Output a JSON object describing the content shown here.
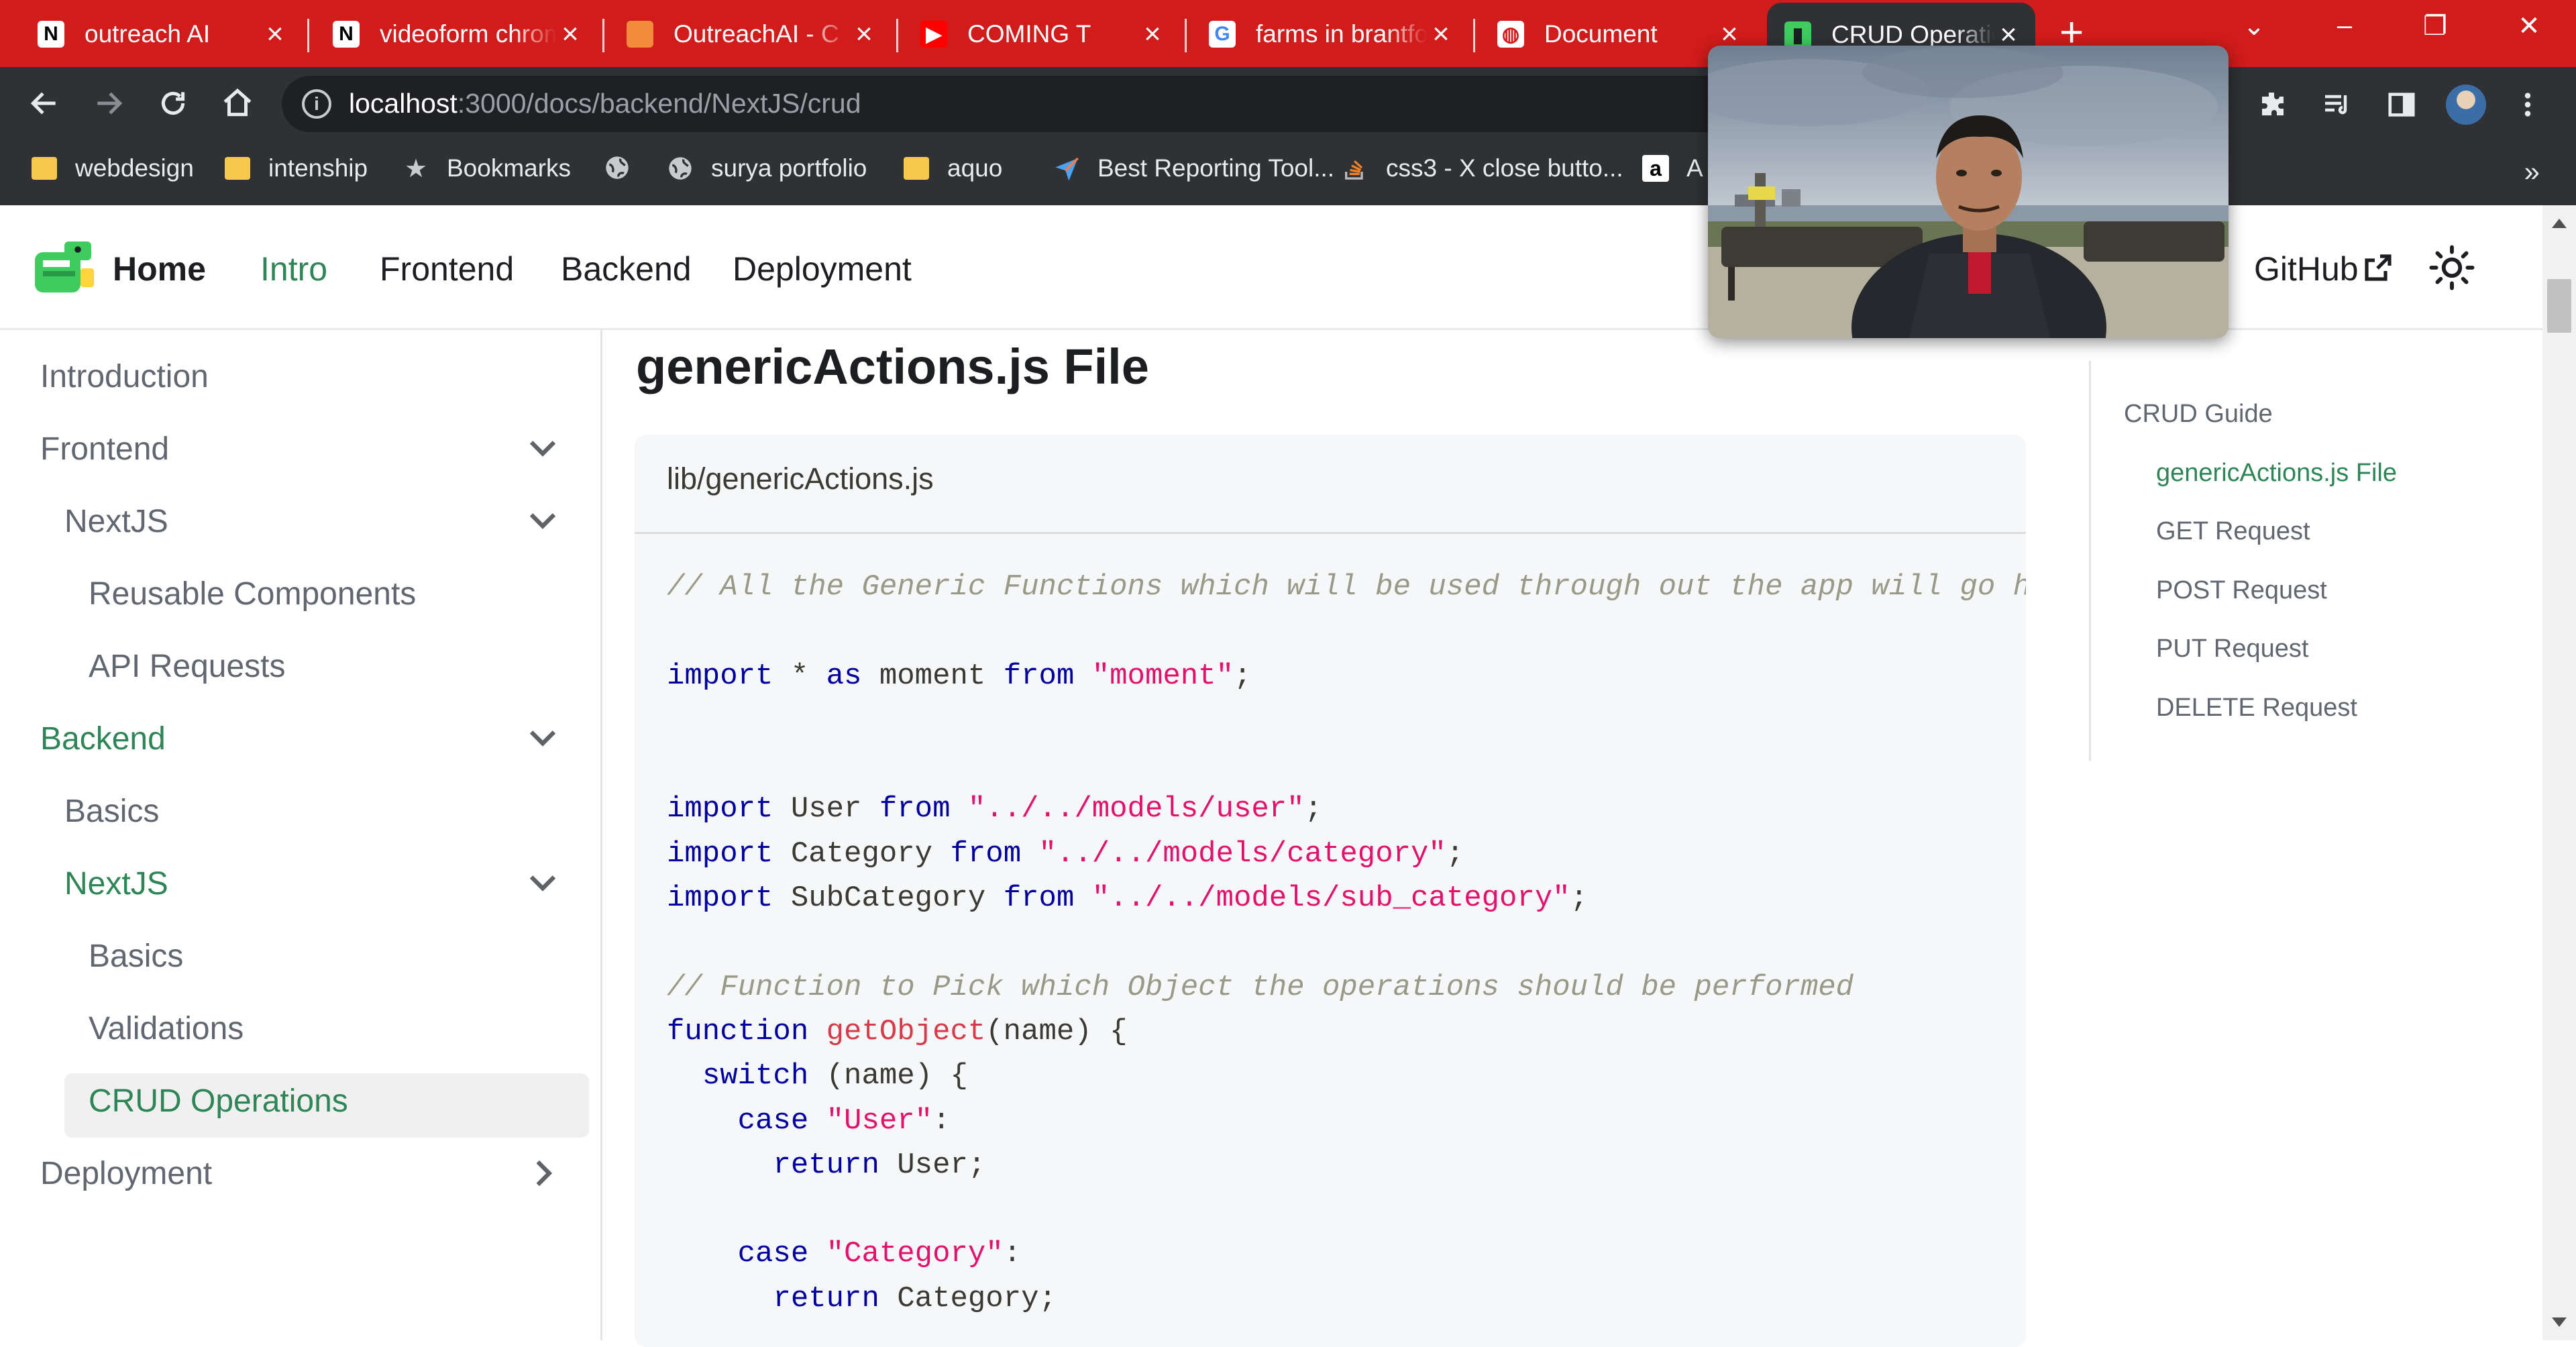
{
  "tabs": [
    {
      "title": "outreach AI",
      "icon": "notion-icon",
      "active": false
    },
    {
      "title": "videoform chrome",
      "icon": "notion-icon",
      "active": false
    },
    {
      "title": "OutreachAI - C",
      "icon": "folder-icon",
      "active": false
    },
    {
      "title": "COMING T",
      "icon": "youtube-icon",
      "active": false
    },
    {
      "title": "farms in brantford",
      "icon": "google-icon",
      "active": false
    },
    {
      "title": "Document",
      "icon": "globe-icon",
      "active": false
    },
    {
      "title": "CRUD Operations",
      "icon": "docusaurus-icon",
      "active": true
    }
  ],
  "address": {
    "host": "localhost",
    "path": ":3000/docs/backend/NextJS/crud"
  },
  "bookmarks": [
    {
      "label": "webdesign",
      "icon": "folder-icon"
    },
    {
      "label": "intenship",
      "icon": "folder-icon"
    },
    {
      "label": "Bookmarks",
      "icon": "star-icon"
    },
    {
      "label": "",
      "icon": "globe-icon"
    },
    {
      "label": "surya portfolio",
      "icon": "globe-icon"
    },
    {
      "label": "aquo",
      "icon": "folder-icon"
    },
    {
      "label": "Best Reporting Tool...",
      "icon": "send-icon"
    },
    {
      "label": "css3 - X close butto...",
      "icon": "stackoverflow-icon"
    },
    {
      "label": "A",
      "icon": "amazon-icon"
    }
  ],
  "site": {
    "nav": {
      "home": "Home",
      "intro": "Intro",
      "frontend": "Frontend",
      "backend": "Backend",
      "deployment": "Deployment",
      "github": "GitHub"
    }
  },
  "sidebar": {
    "items": [
      {
        "label": "Introduction",
        "level": 0,
        "active": false
      },
      {
        "label": "Frontend",
        "level": 0,
        "active": false,
        "chevron": "down"
      },
      {
        "label": "NextJS",
        "level": 1,
        "active": false,
        "chevron": "down"
      },
      {
        "label": "Reusable Components",
        "level": 2,
        "active": false
      },
      {
        "label": "API Requests",
        "level": 2,
        "active": false
      },
      {
        "label": "Backend",
        "level": 0,
        "active": true,
        "chevron": "down"
      },
      {
        "label": "Basics",
        "level": 1,
        "active": false
      },
      {
        "label": "NextJS",
        "level": 1,
        "active": true,
        "chevron": "down"
      },
      {
        "label": "Basics",
        "level": 2,
        "active": false
      },
      {
        "label": "Validations",
        "level": 2,
        "active": false
      },
      {
        "label": "CRUD Operations",
        "level": 2,
        "active": true,
        "selected": true
      },
      {
        "label": "Deployment",
        "level": 0,
        "active": false,
        "chevron": "right"
      }
    ]
  },
  "content": {
    "heading": "genericActions.js File",
    "code_title": "lib/genericActions.js",
    "code_lines": [
      [
        {
          "t": "// All the Generic Functions which will be used through out the app will go here",
          "c": "cmt"
        }
      ],
      [],
      [
        {
          "t": "import",
          "c": "kw"
        },
        {
          "t": " * "
        },
        {
          "t": "as",
          "c": "kw"
        },
        {
          "t": " moment "
        },
        {
          "t": "from",
          "c": "kw"
        },
        {
          "t": " "
        },
        {
          "t": "\"moment\"",
          "c": "str"
        },
        {
          "t": ";"
        }
      ],
      [],
      [],
      [
        {
          "t": "import",
          "c": "kw"
        },
        {
          "t": " User "
        },
        {
          "t": "from",
          "c": "kw"
        },
        {
          "t": " "
        },
        {
          "t": "\"../../models/user\"",
          "c": "str"
        },
        {
          "t": ";"
        }
      ],
      [
        {
          "t": "import",
          "c": "kw"
        },
        {
          "t": " Category "
        },
        {
          "t": "from",
          "c": "kw"
        },
        {
          "t": " "
        },
        {
          "t": "\"../../models/category\"",
          "c": "str"
        },
        {
          "t": ";"
        }
      ],
      [
        {
          "t": "import",
          "c": "kw"
        },
        {
          "t": " SubCategory "
        },
        {
          "t": "from",
          "c": "kw"
        },
        {
          "t": " "
        },
        {
          "t": "\"../../models/sub_category\"",
          "c": "str"
        },
        {
          "t": ";"
        }
      ],
      [],
      [
        {
          "t": "// Function to Pick which Object the operations should be performed",
          "c": "cmt"
        }
      ],
      [
        {
          "t": "function",
          "c": "kw"
        },
        {
          "t": " "
        },
        {
          "t": "getObject",
          "c": "fn"
        },
        {
          "t": "(name) {"
        }
      ],
      [
        {
          "t": "  "
        },
        {
          "t": "switch",
          "c": "kw"
        },
        {
          "t": " (name) {"
        }
      ],
      [
        {
          "t": "    "
        },
        {
          "t": "case",
          "c": "kw"
        },
        {
          "t": " "
        },
        {
          "t": "\"User\"",
          "c": "str"
        },
        {
          "t": ":"
        }
      ],
      [
        {
          "t": "      "
        },
        {
          "t": "return",
          "c": "kw"
        },
        {
          "t": " User;"
        }
      ],
      [],
      [
        {
          "t": "    "
        },
        {
          "t": "case",
          "c": "kw"
        },
        {
          "t": " "
        },
        {
          "t": "\"Category\"",
          "c": "str"
        },
        {
          "t": ":"
        }
      ],
      [
        {
          "t": "      "
        },
        {
          "t": "return",
          "c": "kw"
        },
        {
          "t": " Category;"
        }
      ]
    ]
  },
  "toc": {
    "items": [
      {
        "label": "CRUD Guide",
        "level": 0,
        "active": false
      },
      {
        "label": "genericActions.js File",
        "level": 1,
        "active": true
      },
      {
        "label": "GET Request",
        "level": 1,
        "active": false
      },
      {
        "label": "POST Request",
        "level": 1,
        "active": false
      },
      {
        "label": "PUT Request",
        "level": 1,
        "active": false
      },
      {
        "label": "DELETE Request",
        "level": 1,
        "active": false
      }
    ]
  },
  "colors": {
    "tabstrip": "#d21b1b",
    "chrome_dark": "#2f3135",
    "docs_green": "#2e8555",
    "keyword": "#00009f",
    "string": "#e3116c",
    "comment": "#999988"
  }
}
